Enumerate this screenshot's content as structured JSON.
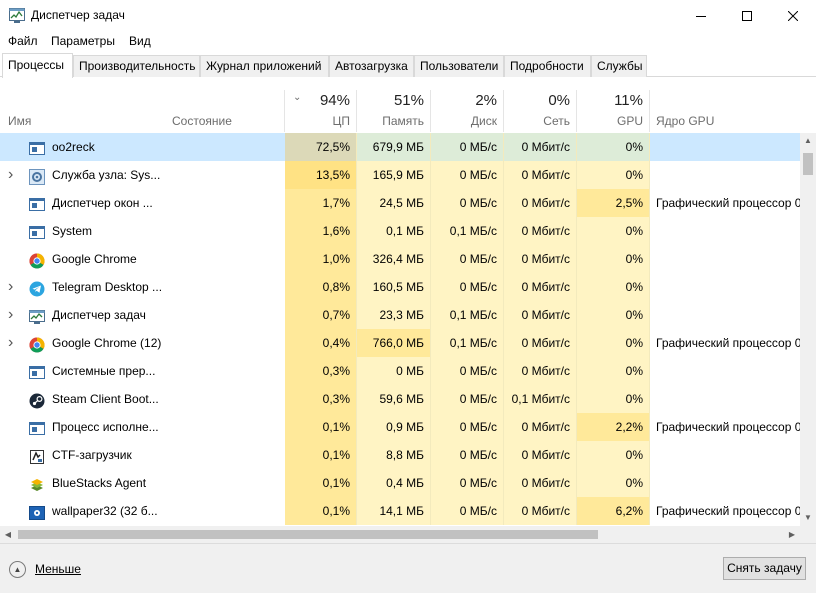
{
  "window": {
    "title": "Диспетчер задач"
  },
  "menu": [
    "Файл",
    "Параметры",
    "Вид"
  ],
  "tabs": [
    "Процессы",
    "Производительность",
    "Журнал приложений",
    "Автозагрузка",
    "Пользователи",
    "Подробности",
    "Службы"
  ],
  "active_tab": "Процессы",
  "columns": {
    "name": "Имя",
    "state": "Состояние",
    "cpu": {
      "pct": "94%",
      "label": "ЦП"
    },
    "mem": {
      "pct": "51%",
      "label": "Память"
    },
    "disk": {
      "pct": "2%",
      "label": "Диск"
    },
    "net": {
      "pct": "0%",
      "label": "Сеть"
    },
    "gpu": {
      "pct": "11%",
      "label": "GPU"
    },
    "gpu_engine": "Ядро GPU"
  },
  "rows": [
    {
      "name": "oo2reck",
      "expand": false,
      "icon": "app-window-icon",
      "cpu": "72,5%",
      "mem": "679,9 МБ",
      "disk": "0 МБ/с",
      "net": "0 Мбит/с",
      "gpu": "0%",
      "engine": "",
      "selected": true
    },
    {
      "name": "Служба узла: Sys...",
      "expand": true,
      "icon": "gear-icon",
      "cpu": "13,5%",
      "mem": "165,9 МБ",
      "disk": "0 МБ/с",
      "net": "0 Мбит/с",
      "gpu": "0%",
      "engine": ""
    },
    {
      "name": "Диспетчер окон ...",
      "expand": false,
      "icon": "app-window-icon",
      "cpu": "1,7%",
      "mem": "24,5 МБ",
      "disk": "0 МБ/с",
      "net": "0 Мбит/с",
      "gpu": "2,5%",
      "engine": "Графический процессор 0"
    },
    {
      "name": "System",
      "expand": false,
      "icon": "app-window-icon",
      "cpu": "1,6%",
      "mem": "0,1 МБ",
      "disk": "0,1 МБ/с",
      "net": "0 Мбит/с",
      "gpu": "0%",
      "engine": ""
    },
    {
      "name": "Google Chrome",
      "expand": false,
      "icon": "chrome-icon",
      "cpu": "1,0%",
      "mem": "326,4 МБ",
      "disk": "0 МБ/с",
      "net": "0 Мбит/с",
      "gpu": "0%",
      "engine": ""
    },
    {
      "name": "Telegram Desktop ...",
      "expand": true,
      "icon": "telegram-icon",
      "cpu": "0,8%",
      "mem": "160,5 МБ",
      "disk": "0 МБ/с",
      "net": "0 Мбит/с",
      "gpu": "0%",
      "engine": ""
    },
    {
      "name": "Диспетчер задач",
      "expand": true,
      "icon": "task-manager-icon",
      "cpu": "0,7%",
      "mem": "23,3 МБ",
      "disk": "0,1 МБ/с",
      "net": "0 Мбит/с",
      "gpu": "0%",
      "engine": ""
    },
    {
      "name": "Google Chrome (12)",
      "expand": true,
      "icon": "chrome-icon",
      "cpu": "0,4%",
      "mem": "766,0 МБ",
      "disk": "0,1 МБ/с",
      "net": "0 Мбит/с",
      "gpu": "0%",
      "engine": "Графический процессор 0"
    },
    {
      "name": "Системные прер...",
      "expand": false,
      "icon": "app-window-icon",
      "cpu": "0,3%",
      "mem": "0 МБ",
      "disk": "0 МБ/с",
      "net": "0 Мбит/с",
      "gpu": "0%",
      "engine": ""
    },
    {
      "name": "Steam Client Boot...",
      "expand": false,
      "icon": "steam-icon",
      "cpu": "0,3%",
      "mem": "59,6 МБ",
      "disk": "0 МБ/с",
      "net": "0,1 Мбит/с",
      "gpu": "0%",
      "engine": ""
    },
    {
      "name": "Процесс исполне...",
      "expand": false,
      "icon": "app-window-icon",
      "cpu": "0,1%",
      "mem": "0,9 МБ",
      "disk": "0 МБ/с",
      "net": "0 Мбит/с",
      "gpu": "2,2%",
      "engine": "Графический процессор 0"
    },
    {
      "name": "CTF-загрузчик",
      "expand": false,
      "icon": "ctf-loader-icon",
      "cpu": "0,1%",
      "mem": "8,8 МБ",
      "disk": "0 МБ/с",
      "net": "0 Мбит/с",
      "gpu": "0%",
      "engine": ""
    },
    {
      "name": "BlueStacks Agent",
      "expand": false,
      "icon": "bluestacks-icon",
      "cpu": "0,1%",
      "mem": "0,4 МБ",
      "disk": "0 МБ/с",
      "net": "0 Мбит/с",
      "gpu": "0%",
      "engine": ""
    },
    {
      "name": "wallpaper32 (32 б...",
      "expand": false,
      "icon": "wallpaper-icon",
      "cpu": "0,1%",
      "mem": "14,1 МБ",
      "disk": "0 МБ/с",
      "net": "0 Мбит/с",
      "gpu": "6,2%",
      "engine": "Графический процессор 0"
    }
  ],
  "footer": {
    "less_label": "Меньше",
    "end_task_label": "Снять задачу"
  },
  "colors": {
    "heat_light": "#fff4c4",
    "heat_mid": "#ffe99a",
    "heat_strong": "#ffe284",
    "selected": "#cce8ff",
    "selected_heat": "#ddecd8"
  }
}
